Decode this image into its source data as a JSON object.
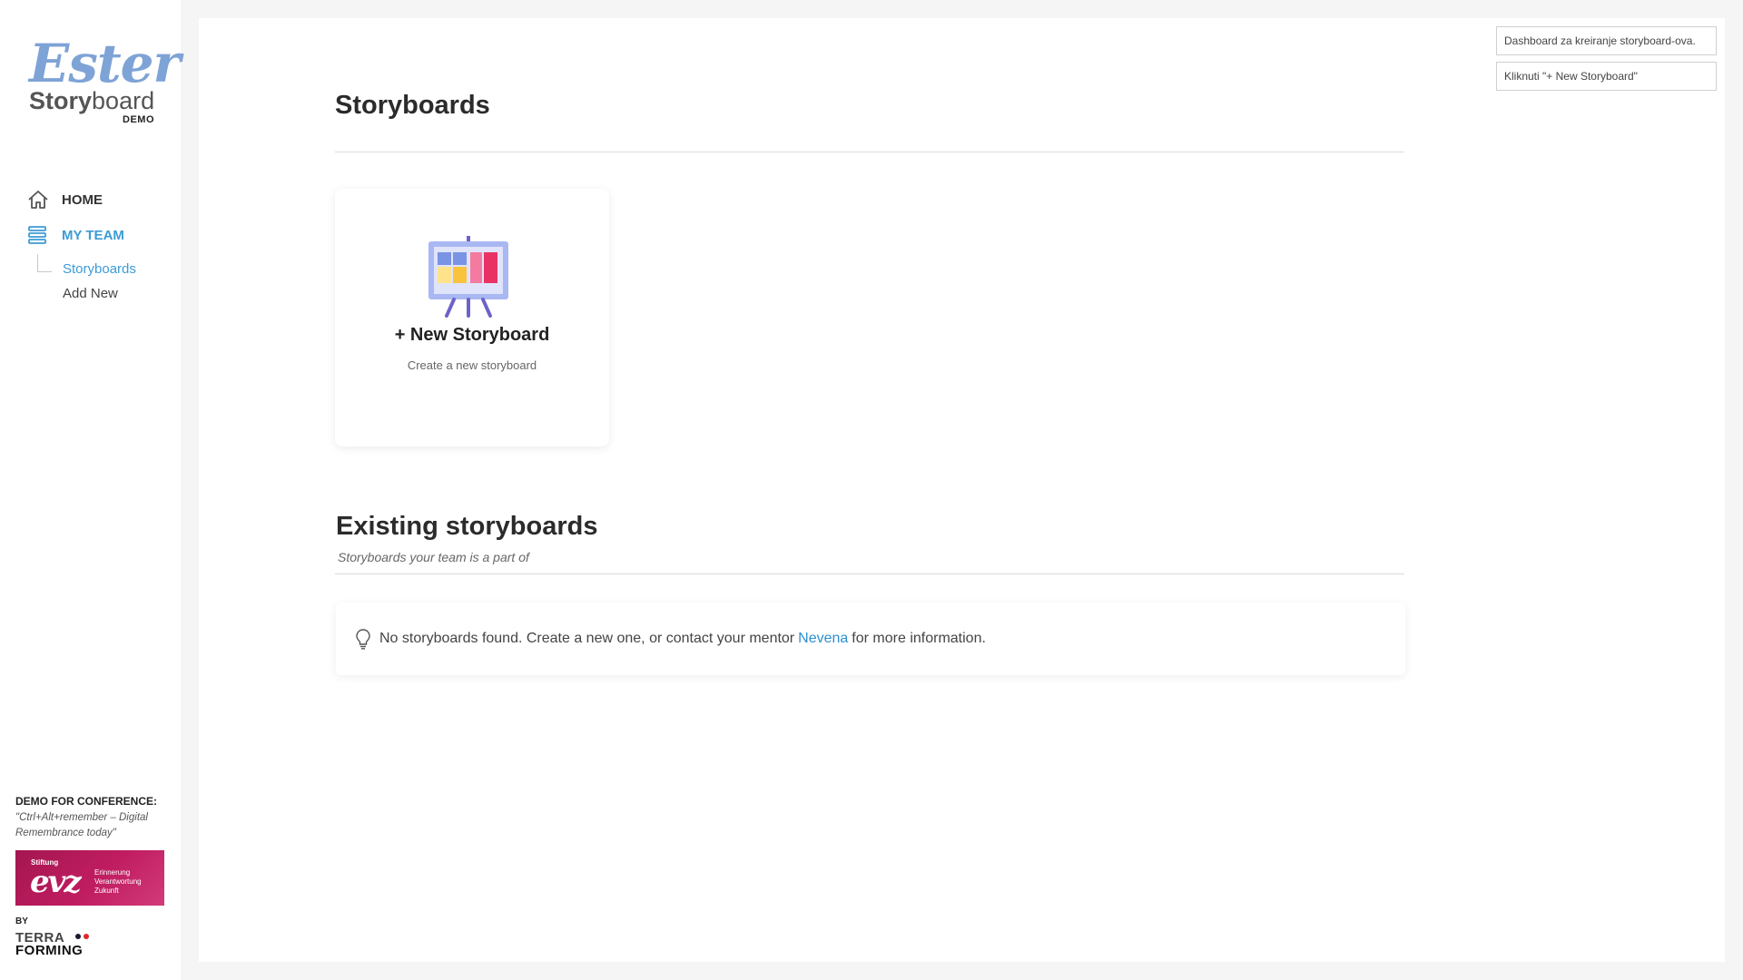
{
  "sidebar": {
    "logo": {
      "script": "Ester",
      "word_bold": "Story",
      "word_light": "board",
      "badge": "DEMO"
    },
    "nav": [
      {
        "label": "HOME",
        "icon": "home-icon",
        "active": false
      },
      {
        "label": "MY TEAM",
        "icon": "stack-icon",
        "active": true
      }
    ],
    "subnav": [
      {
        "label": "Storyboards",
        "active": true
      },
      {
        "label": "Add New",
        "active": false
      }
    ],
    "credits": {
      "title": "DEMO FOR CONFERENCE:",
      "quote": "\"Ctrl+Alt+remember – Digital Remembrance today\"",
      "evz_small": "Stiftung",
      "evz_big": "evz",
      "evz_tagline": [
        "Erinnerung",
        "Verantwortung",
        "Zukunft"
      ],
      "by": "BY",
      "terraforming": [
        "TERRA",
        "FORMING"
      ]
    }
  },
  "main": {
    "title": "Storyboards",
    "new_card": {
      "title": "+ New Storyboard",
      "subtitle": "Create a new storyboard",
      "icon": "presentation-board-icon"
    },
    "existing": {
      "title": "Existing storyboards",
      "subtitle": "Storyboards your team is a part of",
      "notice_before": "No storyboards found. Create a new one, or contact your mentor",
      "notice_link": "Nevena",
      "notice_after": "for more information.",
      "notice_icon": "lightbulb-icon"
    }
  },
  "tooltips": [
    "Dashboard za kreiranje storyboard-ova.",
    "Kliknuti \"+ New Storyboard\""
  ],
  "colors": {
    "accent": "#3c9bd6",
    "link": "#2d8fd0",
    "logo_blue": "#7ea3d6",
    "evz_magenta": "#b3185a",
    "tf_dot_dark": "#1a1a2e",
    "tf_dot_red": "#e0262f"
  }
}
